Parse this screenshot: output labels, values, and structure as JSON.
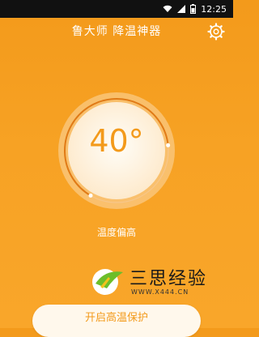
{
  "status_bar": {
    "time": "12:25"
  },
  "app": {
    "title": "鲁大师 降温神器"
  },
  "dial": {
    "temperature": "40°",
    "level_fraction": 0.78
  },
  "status_text": "温度偏高",
  "watermark": {
    "name": "三思经验",
    "url": "WWW.X444.CN"
  },
  "button": {
    "protect_label": "开启高温保护"
  },
  "colors": {
    "accent": "#f39a1b",
    "background": "#f7a224",
    "dial_arc": "#e07a16"
  },
  "icons": [
    "wifi-icon",
    "signal-icon",
    "battery-icon",
    "gear-icon"
  ]
}
